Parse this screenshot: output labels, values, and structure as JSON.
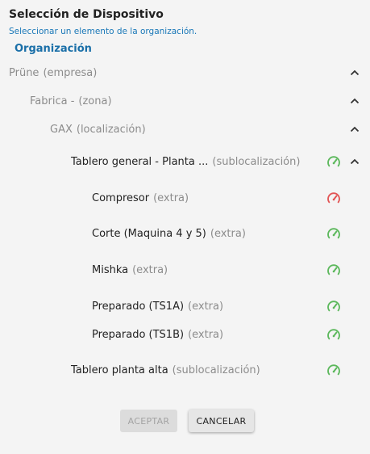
{
  "dialog": {
    "title": "Selección de Dispositivo",
    "subtitle": "Seleccionar un elemento de la organización.",
    "section_label": "Organización"
  },
  "tree": {
    "company": {
      "name": "Prüne",
      "type": "(empresa)"
    },
    "zone": {
      "name": "Fabrica -",
      "type": "(zona)"
    },
    "location": {
      "name": "GAX",
      "type": "(localización)"
    },
    "sub1": {
      "name": "Tablero general - Planta ...",
      "type": "(sublocalización)",
      "status": "ok"
    },
    "devices": [
      {
        "name": "Compresor",
        "type": "(extra)",
        "status": "alert"
      },
      {
        "name": "Corte (Maquina 4 y 5)",
        "type": "(extra)",
        "status": "ok"
      },
      {
        "name": "Mishka",
        "type": "(extra)",
        "status": "ok"
      },
      {
        "name": "Preparado (TS1A)",
        "type": "(extra)",
        "status": "ok"
      },
      {
        "name": "Preparado (TS1B)",
        "type": "(extra)",
        "status": "ok"
      }
    ],
    "sub2": {
      "name": "Tablero planta alta",
      "type": "(sublocalización)",
      "status": "ok"
    }
  },
  "buttons": {
    "accept_label": "ACEPTAR",
    "cancel_label": "CANCELAR"
  },
  "colors": {
    "ok": "#5cb85c",
    "alert": "#e25555",
    "accent": "#1a78b8"
  },
  "icons": {
    "expand": "chevron-up-icon",
    "status": "speedometer-icon"
  }
}
